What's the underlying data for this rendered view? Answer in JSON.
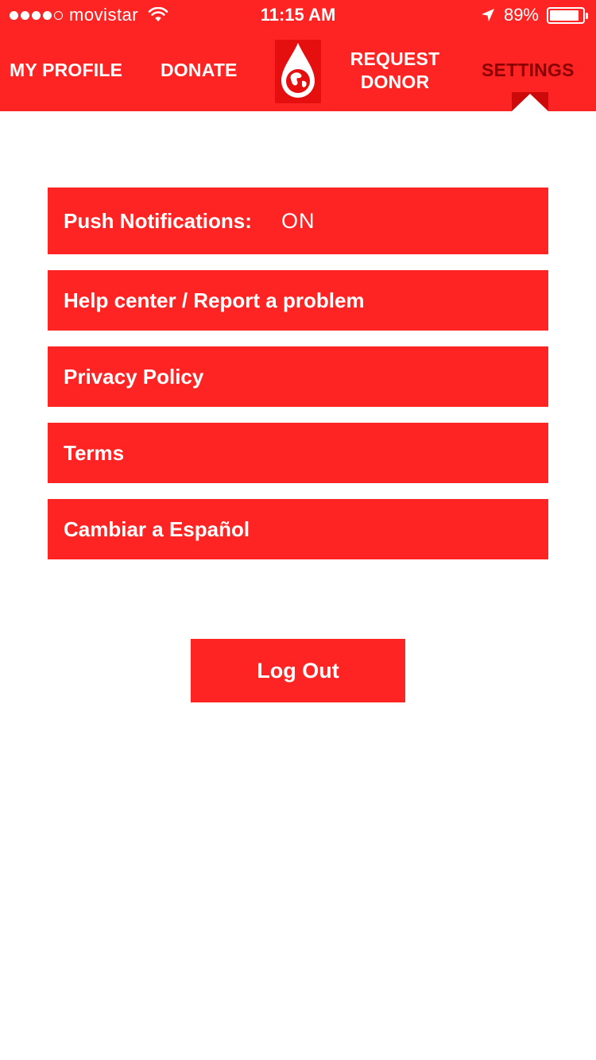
{
  "status_bar": {
    "carrier": "movistar",
    "time": "11:15 AM",
    "battery": "89%",
    "signal_bars_filled": 4,
    "signal_bars_total": 5,
    "battery_level": 0.89
  },
  "nav": {
    "profile": "MY PROFILE",
    "donate": "DONATE",
    "request_line1": "REQUEST",
    "request_line2": "DONOR",
    "settings": "SETTINGS",
    "logo_icon": "blood-drop-globe-icon",
    "active_tab": "settings"
  },
  "settings": {
    "push_label": "Push Notifications:",
    "push_value": "ON",
    "help": "Help center / Report a problem",
    "privacy": "Privacy Policy",
    "terms": "Terms",
    "spanish": "Cambiar a Español"
  },
  "logout_label": "Log Out",
  "colors": {
    "accent": "#ff2424",
    "active_tab_text": "#8a0000",
    "background": "#ffffff"
  }
}
